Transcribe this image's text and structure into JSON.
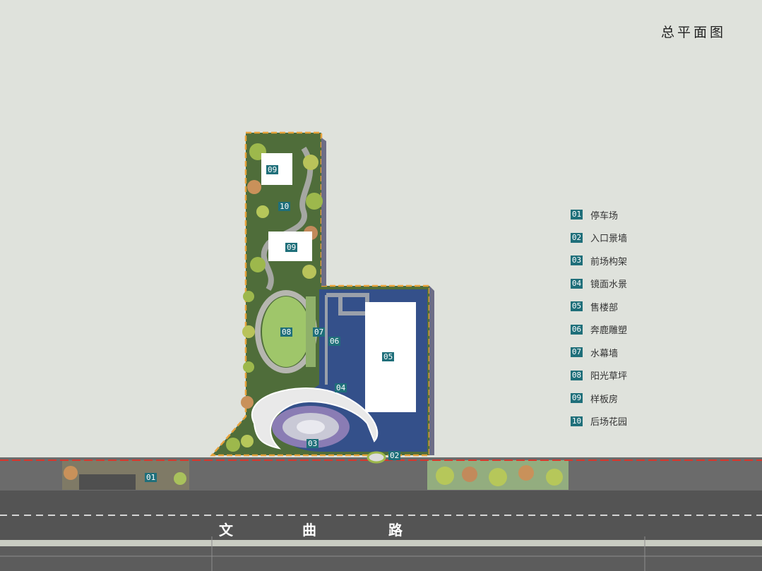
{
  "title": "总平面图",
  "legend": [
    {
      "num": "01",
      "label": "停车场"
    },
    {
      "num": "02",
      "label": "入口景墙"
    },
    {
      "num": "03",
      "label": "前场构架"
    },
    {
      "num": "04",
      "label": "镜面水景"
    },
    {
      "num": "05",
      "label": "售楼部"
    },
    {
      "num": "06",
      "label": "奔鹿雕塑"
    },
    {
      "num": "07",
      "label": "水幕墙"
    },
    {
      "num": "08",
      "label": "阳光草坪"
    },
    {
      "num": "09",
      "label": "样板房"
    },
    {
      "num": "10",
      "label": "后场花园"
    }
  ],
  "road": {
    "chars": [
      "文",
      "曲",
      "路"
    ]
  },
  "plan_tags": {
    "t01": "01",
    "t02": "02",
    "t03": "03",
    "t04": "04",
    "t05": "05",
    "t06": "06",
    "t07": "07",
    "t08": "08",
    "t09a": "09",
    "t09b": "09",
    "t10": "10"
  },
  "colors": {
    "background": "#dfe2dc",
    "water": "#34508a",
    "lawn": "#9fc66a",
    "road": "#5b5b5b",
    "boundary": "#e8a23a",
    "redline": "#d9362c",
    "legend_badge": "#1f6f7a"
  }
}
